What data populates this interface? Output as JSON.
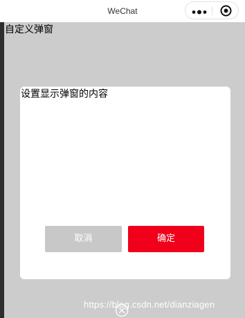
{
  "titlebar": {
    "title": "WeChat",
    "more_icon": "more-dots-icon",
    "target_icon": "target-circle-icon"
  },
  "page": {
    "title": "自定义弹窗"
  },
  "dialog": {
    "content": "设置显示弹窗的内容",
    "cancel_label": "取消",
    "confirm_label": "确定"
  },
  "overlay": {
    "close_icon": "close-circle-icon",
    "watermark": "https://blog.csdn.net/dianziagen"
  },
  "colors": {
    "overlay": "#cccccc",
    "confirm": "#f0001a",
    "cancel": "#c8c8c8"
  }
}
